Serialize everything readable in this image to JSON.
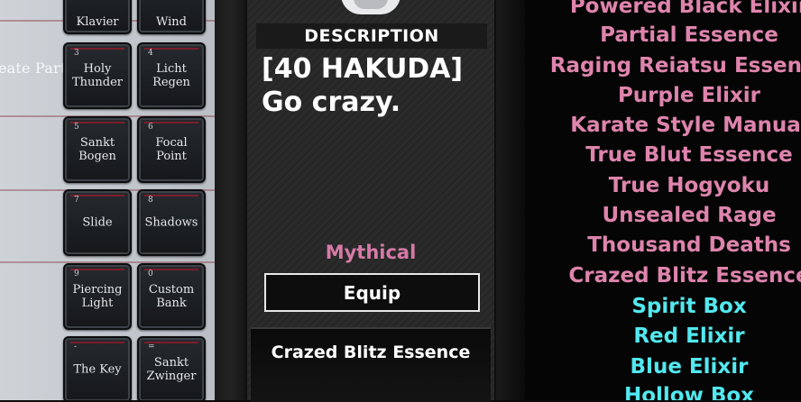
{
  "party_label": "eate Party",
  "slots": [
    {
      "num": "",
      "label": "Klavier"
    },
    {
      "num": "",
      "label": "Wind"
    },
    {
      "num": "3",
      "label": "Holy\nThunder"
    },
    {
      "num": "4",
      "label": "Licht\nRegen"
    },
    {
      "num": "5",
      "label": "Sankt\nBogen"
    },
    {
      "num": "6",
      "label": "Focal\nPoint"
    },
    {
      "num": "7",
      "label": "Slide"
    },
    {
      "num": "8",
      "label": "Shadows"
    },
    {
      "num": "9",
      "label": "Piercing\nLight"
    },
    {
      "num": "0",
      "label": "Custom\nBank"
    },
    {
      "num": "-",
      "label": "The Key"
    },
    {
      "num": "=",
      "label": "Sankt\nZwinger"
    }
  ],
  "description": {
    "header": "DESCRIPTION",
    "text": "[40 HAKUDA]\nGo crazy.",
    "rarity": "Mythical",
    "equip_label": "Equip",
    "selected_item": "Crazed Blitz Essence"
  },
  "inventory": [
    {
      "name": "Powered Black Elixir",
      "color": "pink"
    },
    {
      "name": "Partial Essence",
      "color": "pink"
    },
    {
      "name": "Raging Reiatsu Essence",
      "color": "pink"
    },
    {
      "name": "Purple Elixir",
      "color": "pink"
    },
    {
      "name": "Karate Style Manual",
      "color": "pink"
    },
    {
      "name": "True Blut Essence",
      "color": "pink"
    },
    {
      "name": "True Hogyoku",
      "color": "pink"
    },
    {
      "name": "Unsealed Rage",
      "color": "pink"
    },
    {
      "name": "Thousand Deaths",
      "color": "pink"
    },
    {
      "name": "Crazed Blitz Essence",
      "color": "pink"
    },
    {
      "name": "Spirit Box",
      "color": "cyan"
    },
    {
      "name": "Red Elixir",
      "color": "cyan"
    },
    {
      "name": "Blue Elixir",
      "color": "cyan"
    },
    {
      "name": "Hollow Box",
      "color": "cyan"
    }
  ],
  "colors": {
    "mythical_pink": "#de84ad",
    "rare_cyan": "#52e8ef",
    "slot_accent": "#7c1d2a"
  }
}
